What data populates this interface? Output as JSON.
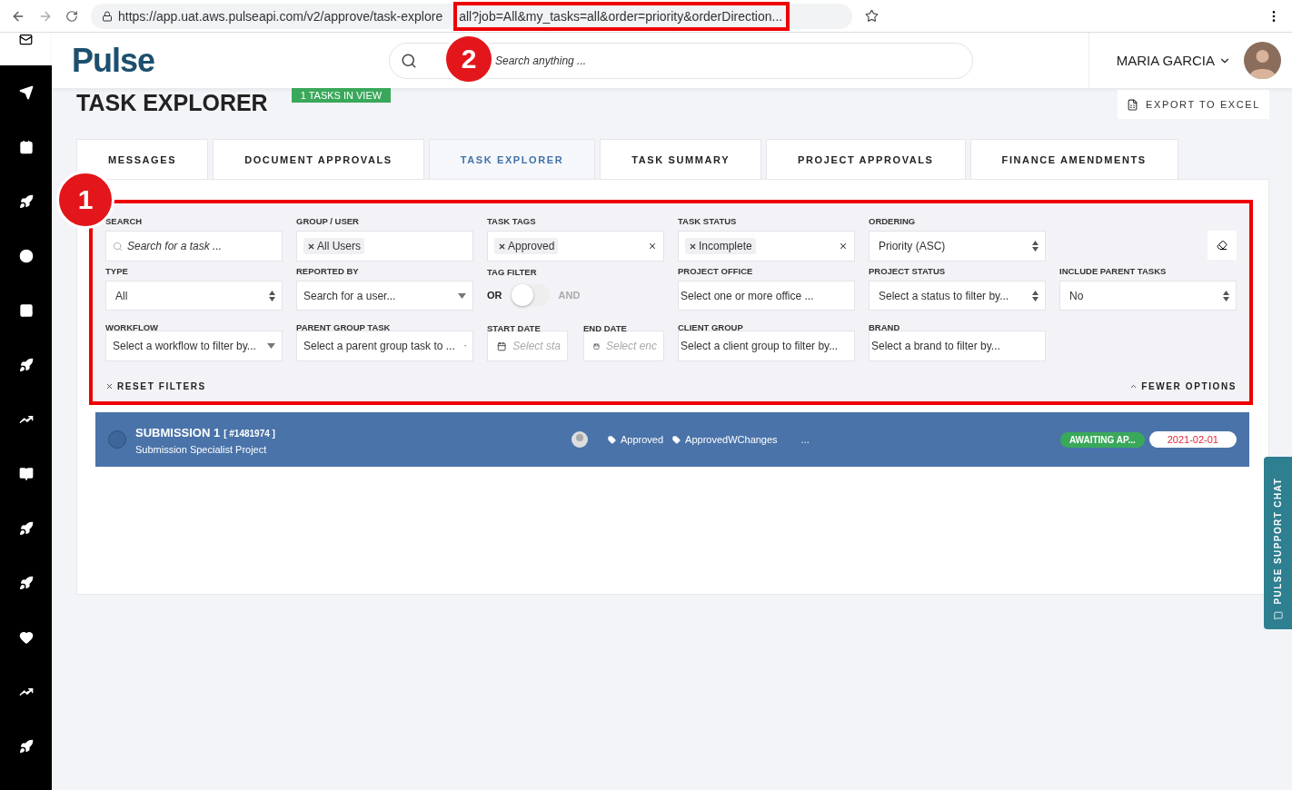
{
  "browser": {
    "url": "https://app.uat.aws.pulseapi.com/v2/approve/task-explore",
    "url_highlighted": "all?job=All&my_tasks=all&order=priority&orderDirection..."
  },
  "header": {
    "logo": "Pulse",
    "search_placeholder": "Search anything ...",
    "user": "MARIA GARCIA"
  },
  "page": {
    "title": "TASK EXPLORER",
    "count_badge": "1 TASKS IN VIEW",
    "export_button": "EXPORT TO EXCEL"
  },
  "tabs": [
    {
      "label": "MESSAGES",
      "selected": false
    },
    {
      "label": "DOCUMENT APPROVALS",
      "selected": false
    },
    {
      "label": "TASK EXPLORER",
      "selected": true
    },
    {
      "label": "TASK SUMMARY",
      "selected": false
    },
    {
      "label": "PROJECT APPROVALS",
      "selected": false
    },
    {
      "label": "FINANCE AMENDMENTS",
      "selected": false
    }
  ],
  "filters": [
    {
      "kind": "search",
      "label": "SEARCH",
      "placeholder": "Search for a task ..."
    },
    {
      "kind": "tags",
      "label": "GROUP / USER",
      "tags": [
        "All Users"
      ],
      "clearable": false
    },
    {
      "kind": "tags",
      "label": "TASK TAGS",
      "tags": [
        "Approved"
      ],
      "clearable": true
    },
    {
      "kind": "tags",
      "label": "TASK STATUS",
      "tags": [
        "Incomplete"
      ],
      "clearable": true
    },
    {
      "kind": "select",
      "label": "ORDERING",
      "value": "Priority (ASC)"
    },
    {
      "kind": "action"
    },
    {
      "kind": "select",
      "label": "TYPE",
      "value": "All"
    },
    {
      "kind": "dropdown",
      "label": "REPORTED BY",
      "placeholder": "Search for a user..."
    },
    {
      "kind": "toggle",
      "label": "TAG FILTER",
      "left": "OR",
      "right": "AND",
      "on": false
    },
    {
      "kind": "text",
      "label": "PROJECT OFFICE",
      "placeholder": "Select one or more office ..."
    },
    {
      "kind": "select",
      "label": "PROJECT STATUS",
      "placeholder": "Select a status to filter by..."
    },
    {
      "kind": "select",
      "label": "INCLUDE PARENT TASKS",
      "value": "No"
    },
    {
      "kind": "dropdown",
      "label": "WORKFLOW",
      "placeholder": "Select a workflow to filter by..."
    },
    {
      "kind": "dropdown",
      "label": "PARENT GROUP TASK",
      "placeholder": "Select a parent group task to ..."
    },
    {
      "kind": "dates",
      "items": [
        {
          "label": "START DATE",
          "placeholder": "Select sta"
        },
        {
          "label": "END DATE",
          "placeholder": "Select enc"
        }
      ]
    },
    {
      "kind": "text",
      "label": "CLIENT GROUP",
      "placeholder": "Select a client group to filter by..."
    },
    {
      "kind": "text",
      "label": "BRAND",
      "placeholder": "Select a brand to filter by..."
    }
  ],
  "filter_actions": {
    "reset": "RESET FILTERS",
    "toggle": "FEWER OPTIONS"
  },
  "tasks": [
    {
      "title": "SUBMISSION 1",
      "id": "[ #1481974 ]",
      "project": "Submission Specialist Project",
      "checked": false,
      "tags": [
        "Approved",
        "ApprovedWChanges"
      ],
      "more": "...",
      "status": "AWAITING AP...",
      "date": "2021-02-01"
    }
  ],
  "support_chat": "PULSE SUPPORT CHAT",
  "annotations": [
    {
      "number": "1"
    },
    {
      "number": "2"
    }
  ]
}
